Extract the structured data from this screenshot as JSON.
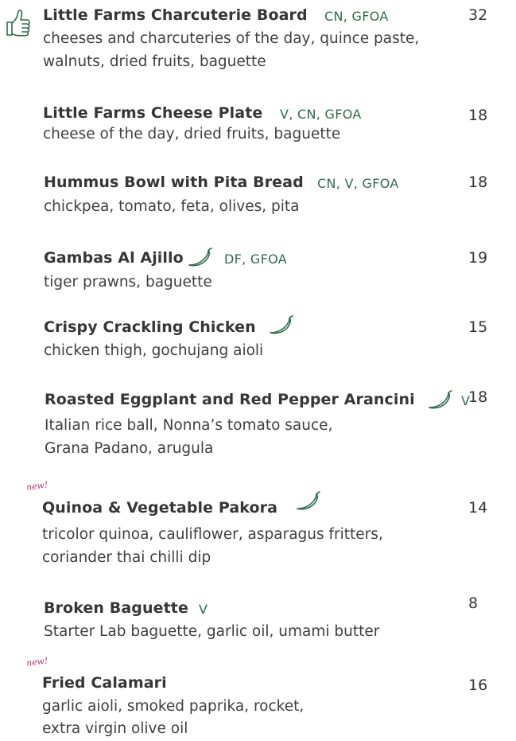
{
  "menu": {
    "items": [
      {
        "name": "Little Farms Charcuterie Board",
        "tags": "CN, GFOA",
        "price": "32",
        "desc": [
          "cheeses and charcuteries of the day, quince paste,",
          "walnuts, dried fruits, baguette"
        ],
        "icon": "thumbs-up-icon"
      },
      {
        "name": "Little Farms Cheese Plate",
        "tags": "V, CN, GFOA",
        "price": "18",
        "desc": [
          "cheese of the day, dried fruits, baguette"
        ]
      },
      {
        "name": "Hummus Bowl with Pita Bread",
        "tags": "CN, V, GFOA",
        "price": "18",
        "desc": [
          "chickpea, tomato, feta, olives, pita"
        ]
      },
      {
        "name": "Gambas Al Ajillo",
        "tags": "DF, GFOA",
        "price": "19",
        "desc": [
          "tiger prawns, baguette"
        ],
        "icon": "chilli-icon"
      },
      {
        "name": "Crispy Crackling Chicken",
        "tags": "",
        "price": "15",
        "desc": [
          "chicken thigh, gochujang aioli"
        ],
        "icon": "chilli-icon"
      },
      {
        "name": "Roasted Eggplant and Red Pepper Arancini",
        "tags": "V",
        "price": "18",
        "desc": [
          "Italian rice ball, Nonna’s tomato sauce,",
          "Grana Padano, arugula"
        ],
        "icon": "chilli-icon"
      },
      {
        "name": "Quinoa & Vegetable Pakora",
        "tags": "",
        "price": "14",
        "badge": "new!",
        "desc": [
          "tricolor quinoa, cauliflower, asparagus fritters,",
          "coriander thai chilli dip"
        ],
        "icon": "chilli-icon"
      },
      {
        "name": "Broken Baguette",
        "tags": "V",
        "price": "8",
        "desc": [
          "Starter Lab baguette, garlic oil,  umami butter"
        ]
      },
      {
        "name": "Fried Calamari",
        "tags": "",
        "price": "16",
        "badge": "new!",
        "desc": [
          "garlic aioli, smoked paprika, rocket,",
          "extra virgin olive oil"
        ]
      }
    ]
  },
  "colors": {
    "text": "#363636",
    "tags": "#2e6b4b",
    "badge": "#b0357a",
    "icon_stroke": "#2e6b4b"
  }
}
